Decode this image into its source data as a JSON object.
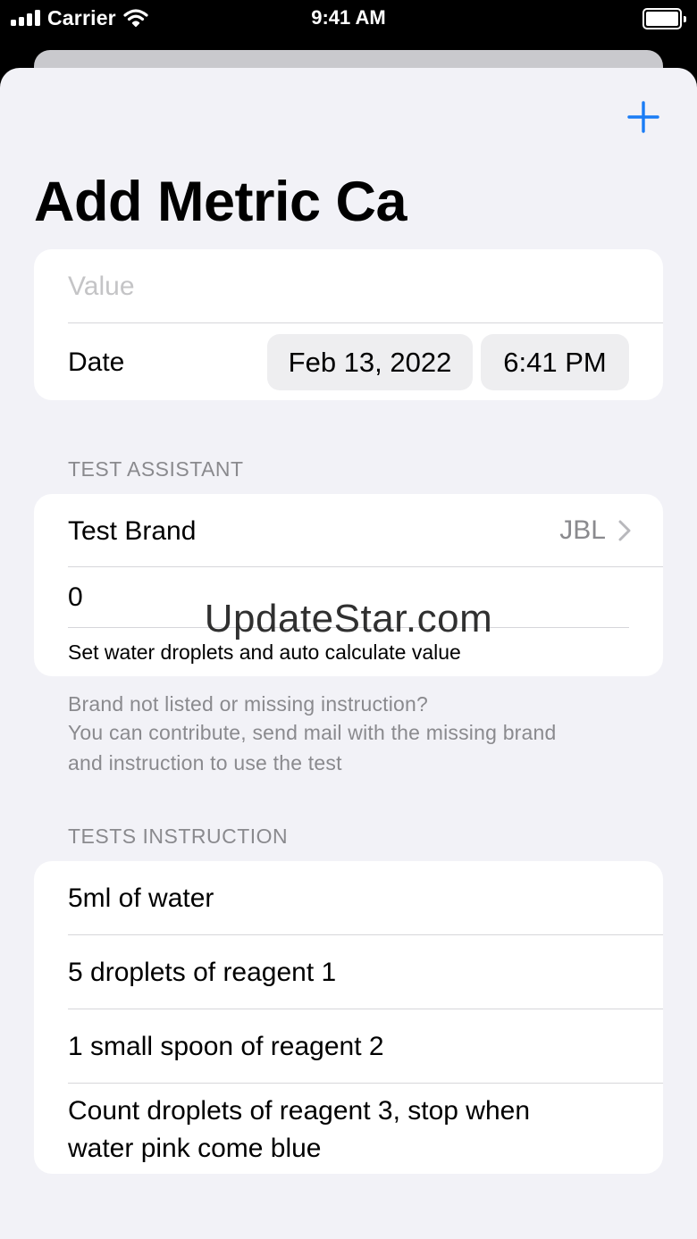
{
  "status_bar": {
    "carrier": "Carrier",
    "time": "9:41 AM"
  },
  "screen": {
    "title": "Add Metric Ca",
    "add_icon": "plus-icon"
  },
  "entry": {
    "value_placeholder": "Value",
    "date_label": "Date",
    "date_value": "Feb 13, 2022",
    "time_value": "6:41 PM"
  },
  "test_assistant": {
    "header": "TEST ASSISTANT",
    "brand_label": "Test Brand",
    "brand_value": "JBL",
    "droplets_value": "0",
    "helper_text": "Set water droplets and auto calculate value",
    "footer_lines": [
      "Brand not listed or missing instruction?",
      "You can contribute, send mail with the missing brand",
      "and instruction to use the test"
    ]
  },
  "tests_instruction": {
    "header": "TESTS INSTRUCTION",
    "items": [
      "5ml of water",
      "5 droplets of reagent 1",
      "1 small spoon of reagent 2",
      "Count droplets of reagent 3, stop when water pink come blue"
    ]
  },
  "watermark": "UpdateStar.com",
  "colors": {
    "accent": "#1a7cf5",
    "background": "#f2f2f7",
    "card": "#ffffff",
    "secondary_text": "#8a8a8e"
  }
}
